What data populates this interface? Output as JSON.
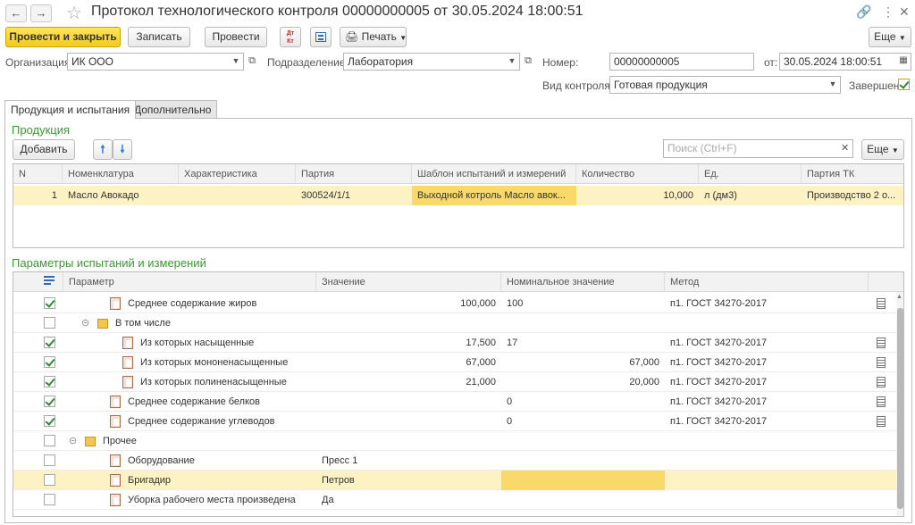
{
  "window": {
    "title": "Протокол технологического контроля 00000000005 от 30.05.2024 18:00:51"
  },
  "toolbar": {
    "post_close_label": "Провести и закрыть",
    "save_label": "Записать",
    "post_label": "Провести",
    "dtkt_label": "Дт Кт",
    "print_label": "Печать",
    "more_label": "Еще"
  },
  "header": {
    "org_label": "Организация:",
    "org_value": "ИК ООО",
    "division_label": "Подразделение:",
    "division_value": "Лаборатория",
    "number_label": "Номер:",
    "number_value": "00000000005",
    "date_label": "от:",
    "date_value": "30.05.2024 18:00:51",
    "control_type_label": "Вид контроля:",
    "control_type_value": "Готовая продукция",
    "completed_label": "Завершен:",
    "completed_checked": true
  },
  "tabs": [
    {
      "label": "Продукция и испытания",
      "active": true
    },
    {
      "label": "Дополнительно",
      "active": false
    }
  ],
  "products": {
    "section_title": "Продукция",
    "add_label": "Добавить",
    "search_placeholder": "Поиск (Ctrl+F)",
    "more_label": "Еще",
    "columns": [
      "N",
      "Номенклатура",
      "Характеристика",
      "Партия",
      "Шаблон испытаний и измерений",
      "Количество",
      "Ед.",
      "Партия ТК"
    ],
    "rows": [
      {
        "n": "1",
        "item": "Масло Авокадо",
        "characteristic": "",
        "batch": "300524/1/1",
        "template": "Выходной котроль Масло авок...",
        "quantity": "10,000",
        "unit": "л (дм3)",
        "tk_batch": "Производство 2 о..."
      }
    ]
  },
  "params": {
    "section_title": "Параметры испытаний и измерений",
    "columns": [
      "Параметр",
      "Значение",
      "Номинальное значение",
      "Метод"
    ],
    "rows": [
      {
        "checked": true,
        "name": "Среднее содержание жиров",
        "value": "100,000",
        "nominal_left": "100",
        "nominal_right": "",
        "method": "п1. ГОСТ 34270-2017",
        "level": 1,
        "group": false
      },
      {
        "checked": false,
        "name": "В том числе",
        "value": "",
        "nominal_left": "",
        "nominal_right": "",
        "method": "",
        "level": 1,
        "group": true
      },
      {
        "checked": true,
        "name": "Из которых насыщенные",
        "value": "17,500",
        "nominal_left": "17",
        "nominal_right": "",
        "method": "п1. ГОСТ 34270-2017",
        "level": 2,
        "group": false
      },
      {
        "checked": true,
        "name": "Из которых мононенасыщенные",
        "value": "67,000",
        "nominal_left": "",
        "nominal_right": "67,000",
        "method": "п1. ГОСТ 34270-2017",
        "level": 2,
        "group": false
      },
      {
        "checked": true,
        "name": "Из которых полиненасыщенные",
        "value": "21,000",
        "nominal_left": "",
        "nominal_right": "20,000",
        "method": "п1. ГОСТ 34270-2017",
        "level": 2,
        "group": false
      },
      {
        "checked": true,
        "name": "Среднее содержание белков",
        "value": "",
        "nominal_left": "0",
        "nominal_right": "",
        "method": "п1. ГОСТ 34270-2017",
        "level": 1,
        "group": false
      },
      {
        "checked": true,
        "name": "Среднее содержание углеводов",
        "value": "",
        "nominal_left": "0",
        "nominal_right": "",
        "method": "п1. ГОСТ 34270-2017",
        "level": 1,
        "group": false
      },
      {
        "checked": false,
        "name": "Прочее",
        "value": "",
        "nominal_left": "",
        "nominal_right": "",
        "method": "",
        "level": 0,
        "group": true
      },
      {
        "checked": false,
        "name": "Оборудование",
        "value": "Пресс 1",
        "nominal_left": "",
        "nominal_right": "",
        "method": "",
        "level": 1,
        "group": false
      },
      {
        "checked": false,
        "name": "Бригадир",
        "value": "Петров",
        "nominal_left": "",
        "nominal_right": "",
        "method": "",
        "level": 1,
        "group": false
      },
      {
        "checked": false,
        "name": "Уборка рабочего места произведена",
        "value": "Да",
        "nominal_left": "",
        "nominal_right": "",
        "method": "",
        "level": 1,
        "group": false
      }
    ]
  },
  "colors": {
    "accent_yellow": "#f5cb19",
    "selected_row": "#fdf2c4",
    "section_green": "#3a9a34"
  }
}
